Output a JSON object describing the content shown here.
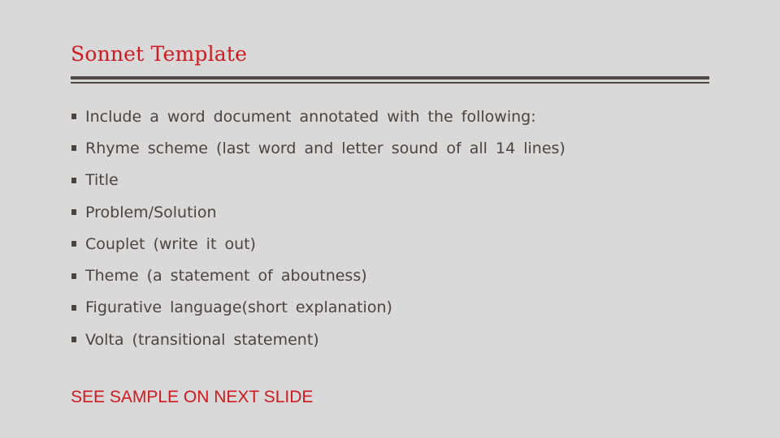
{
  "slide": {
    "title": "Sonnet Template",
    "bullets": [
      {
        "text": "Include a word document annotated with the following:"
      },
      {
        "text": "Rhyme scheme (last word and letter sound of all 14 lines)"
      },
      {
        "text": "Title"
      },
      {
        "text": "Problem/Solution"
      },
      {
        "text": "Couplet (write it out)"
      },
      {
        "text": "Theme (a statement of aboutness)"
      },
      {
        "text": "Figurative language(short explanation)"
      },
      {
        "text": "Volta (transitional statement)"
      }
    ],
    "note": "SEE SAMPLE ON NEXT SLIDE",
    "colors": {
      "background": "#d9d9d9",
      "accent": "#d01a1f",
      "text": "#4a4442",
      "rule": "#4e4846"
    }
  }
}
